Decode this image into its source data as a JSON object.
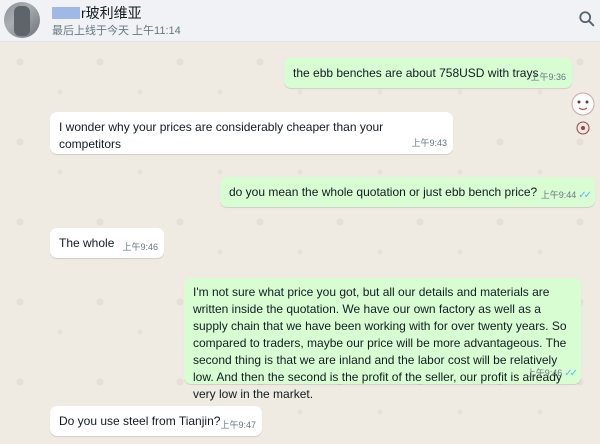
{
  "header": {
    "contact_name": "r玻利维亚",
    "last_seen": "最后上线于今天 上午11:14"
  },
  "colors": {
    "incoming_bubble": "#ffffff",
    "outgoing_bubble": "#d9fdd3",
    "read_ticks": "#53bdeb",
    "chat_background": "#efeae2"
  },
  "icons": {
    "search": "search-icon",
    "read_receipt": "double-check-icon"
  },
  "messages": [
    {
      "direction": "out",
      "text": "the ebb benches are about 758USD with trays",
      "time": "上午9:36",
      "ticks": ""
    },
    {
      "direction": "in",
      "text": "I wonder why your prices are considerably cheaper than your competitors",
      "time": "上午9:43"
    },
    {
      "direction": "out",
      "text": "do you mean the whole quotation or just ebb bench price?",
      "time": "上午9:44",
      "ticks": "✓✓"
    },
    {
      "direction": "in",
      "text": "The whole",
      "time": "上午9:46"
    },
    {
      "direction": "out",
      "text": "I'm not sure what price you got, but all our details and materials are written inside the quotation. We have our own factory as well as a supply chain that we have been working with for over twenty years. So compared to traders, maybe our price will be more advantageous. The second thing is that we are inland and the labor cost will be relatively low. And then the second is the profit of the seller, our profit is already very low in the market.",
      "time": "上午9:46",
      "ticks": "✓✓"
    },
    {
      "direction": "in",
      "text": "Do you use steel from Tianjin?",
      "time": "上午9:47"
    }
  ]
}
